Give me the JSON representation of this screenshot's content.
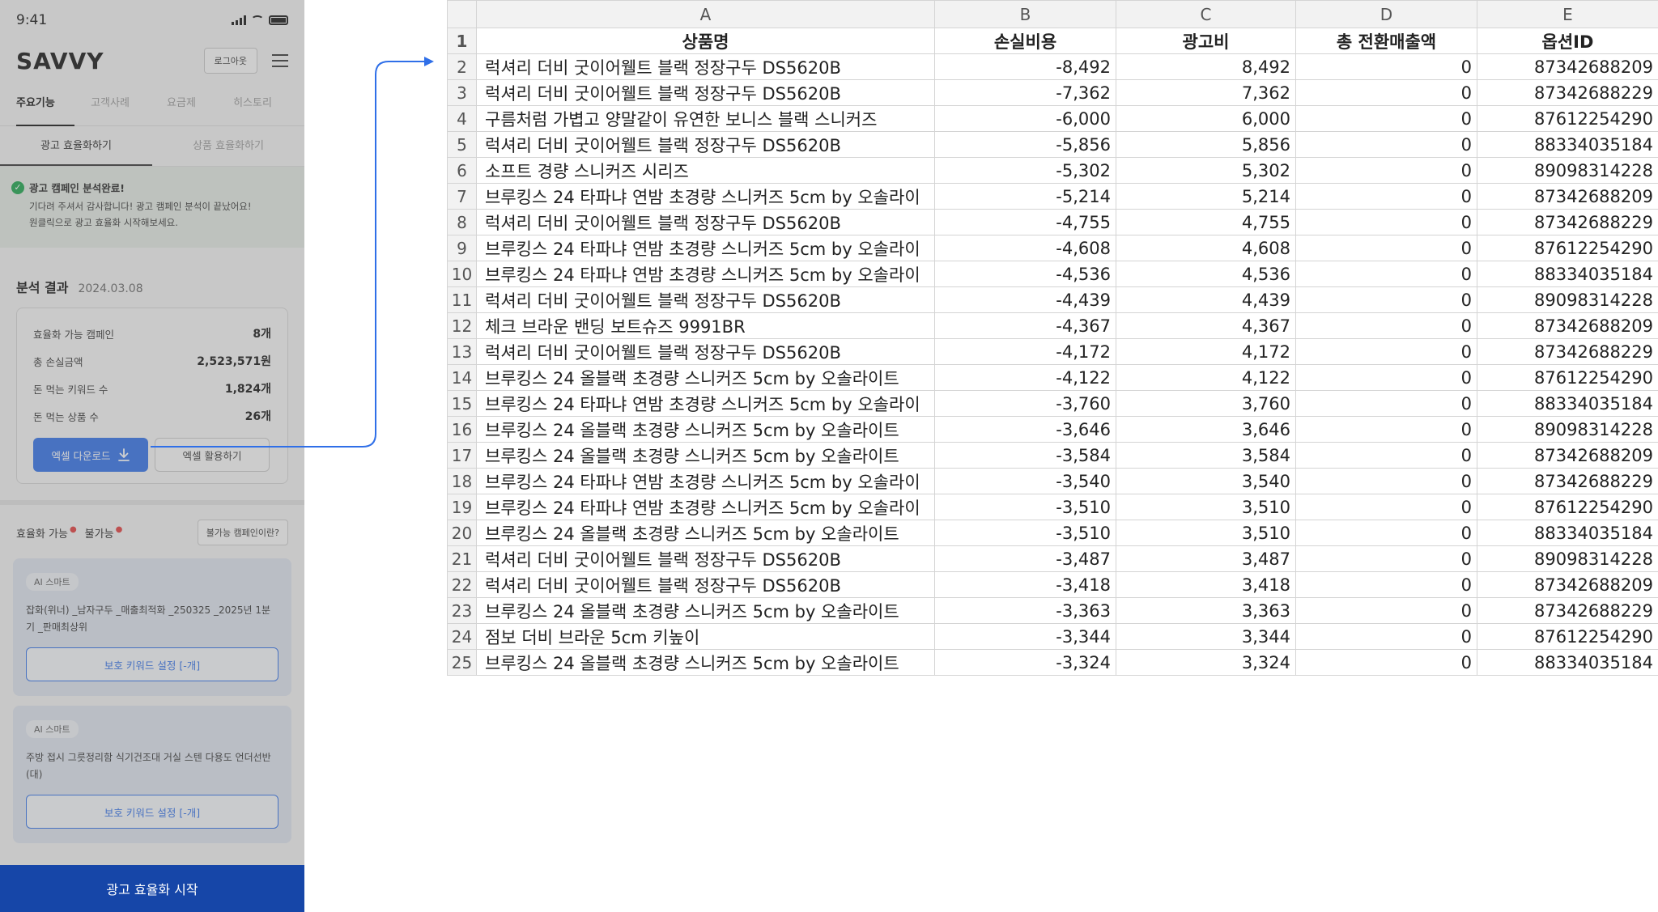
{
  "phone": {
    "status_time": "9:41",
    "logo": "SAVVY",
    "logout_label": "로그아웃",
    "nav_tabs": [
      "주요기능",
      "고객사례",
      "요금제",
      "히스토리"
    ],
    "sub_tabs": [
      "광고 효율화하기",
      "상품 효율화하기"
    ],
    "notice": {
      "title": "광고 캠페인 분석완료!",
      "line1": "기다려 주셔서 감사합니다! 광고 캠페인 분석이 끝났어요!",
      "line2": "원클릭으로 광고 효율화 시작해보세요."
    },
    "analysis": {
      "title": "분석 결과",
      "date": "2024.03.08",
      "stats": [
        {
          "label": "효율화 가능 캠페인",
          "value": "8개"
        },
        {
          "label": "총 손실금액",
          "value": "2,523,571원"
        },
        {
          "label": "돈 먹는 키워드 수",
          "value": "1,824개"
        },
        {
          "label": "돈 먹는 상품 수",
          "value": "26개"
        }
      ],
      "download_label": "엑셀 다운로드",
      "use_label": "엑셀 활용하기"
    },
    "filter": {
      "possible": "효율화 가능",
      "impossible": "불가능",
      "dot": "●",
      "why_label": "불가능 캠페인이란?"
    },
    "campaigns": [
      {
        "badge": "AI 스마트",
        "name": "잡화(위너) _남자구두 _매출최적화 _250325 _2025년 1분기 _판매최상위",
        "button": "보호 키워드 설정 [-개]"
      },
      {
        "badge": "AI 스마트",
        "name": "주방 접시 그릇정리함 식기건조대 거실 스텐 다용도 언더선반 (대)",
        "button": "보호 키워드 설정 [-개]"
      }
    ],
    "cta_label": "광고 효율화 시작"
  },
  "sheet": {
    "columns": [
      "A",
      "B",
      "C",
      "D",
      "E"
    ],
    "headers": [
      "상품명",
      "손실비용",
      "광고비",
      "총 전환매출액",
      "옵션ID"
    ],
    "rows": [
      [
        "럭셔리 더비 굿이어웰트 블랙 정장구두 DS5620B",
        "-8,492",
        "8,492",
        "0",
        "87342688209"
      ],
      [
        "럭셔리 더비 굿이어웰트 블랙 정장구두 DS5620B",
        "-7,362",
        "7,362",
        "0",
        "87342688229"
      ],
      [
        "구름처럼 가볍고 양말같이 유연한 보니스 블랙 스니커즈",
        "-6,000",
        "6,000",
        "0",
        "87612254290"
      ],
      [
        "럭셔리 더비 굿이어웰트 블랙 정장구두 DS5620B",
        "-5,856",
        "5,856",
        "0",
        "88334035184"
      ],
      [
        "소프트 경량 스니커즈 시리즈",
        "-5,302",
        "5,302",
        "0",
        "89098314228"
      ],
      [
        "브루킹스 24 타파냐 연밤 초경량 스니커즈 5cm by 오솔라이",
        "-5,214",
        "5,214",
        "0",
        "87342688209"
      ],
      [
        "럭셔리 더비 굿이어웰트 블랙 정장구두 DS5620B",
        "-4,755",
        "4,755",
        "0",
        "87342688229"
      ],
      [
        "브루킹스 24 타파냐 연밤 초경량 스니커즈 5cm by 오솔라이",
        "-4,608",
        "4,608",
        "0",
        "87612254290"
      ],
      [
        "브루킹스 24 타파냐 연밤 초경량 스니커즈 5cm by 오솔라이",
        "-4,536",
        "4,536",
        "0",
        "88334035184"
      ],
      [
        "럭셔리 더비 굿이어웰트 블랙 정장구두 DS5620B",
        "-4,439",
        "4,439",
        "0",
        "89098314228"
      ],
      [
        "체크 브라운 밴딩 보트슈즈 9991BR",
        "-4,367",
        "4,367",
        "0",
        "87342688209"
      ],
      [
        "럭셔리 더비 굿이어웰트 블랙 정장구두 DS5620B",
        "-4,172",
        "4,172",
        "0",
        "87342688229"
      ],
      [
        "브루킹스 24 올블랙 초경량 스니커즈 5cm by 오솔라이트",
        "-4,122",
        "4,122",
        "0",
        "87612254290"
      ],
      [
        "브루킹스 24 타파냐 연밤 초경량 스니커즈 5cm by 오솔라이",
        "-3,760",
        "3,760",
        "0",
        "88334035184"
      ],
      [
        "브루킹스 24 올블랙 초경량 스니커즈 5cm by 오솔라이트",
        "-3,646",
        "3,646",
        "0",
        "89098314228"
      ],
      [
        "브루킹스 24 올블랙 초경량 스니커즈 5cm by 오솔라이트",
        "-3,584",
        "3,584",
        "0",
        "87342688209"
      ],
      [
        "브루킹스 24 타파냐 연밤 초경량 스니커즈 5cm by 오솔라이",
        "-3,540",
        "3,540",
        "0",
        "87342688229"
      ],
      [
        "브루킹스 24 타파냐 연밤 초경량 스니커즈 5cm by 오솔라이",
        "-3,510",
        "3,510",
        "0",
        "87612254290"
      ],
      [
        "브루킹스 24 올블랙 초경량 스니커즈 5cm by 오솔라이트",
        "-3,510",
        "3,510",
        "0",
        "88334035184"
      ],
      [
        "럭셔리 더비 굿이어웰트 블랙 정장구두 DS5620B",
        "-3,487",
        "3,487",
        "0",
        "89098314228"
      ],
      [
        "럭셔리 더비 굿이어웰트 블랙 정장구두 DS5620B",
        "-3,418",
        "3,418",
        "0",
        "87342688209"
      ],
      [
        "브루킹스 24 올블랙 초경량 스니커즈 5cm by 오솔라이트",
        "-3,363",
        "3,363",
        "0",
        "87342688229"
      ],
      [
        "점보 더비 브라운 5cm 키높이",
        "-3,344",
        "3,344",
        "0",
        "87612254290"
      ],
      [
        "브루킹스 24 올블랙 초경량 스니커즈 5cm by 오솔라이트",
        "-3,324",
        "3,324",
        "0",
        "88334035184"
      ]
    ]
  },
  "colors": {
    "primary_blue": "#2f6fe8",
    "cta_navy": "#1646a8",
    "success_green": "#1aa34a",
    "required_dot_red": "#e23b3b"
  }
}
